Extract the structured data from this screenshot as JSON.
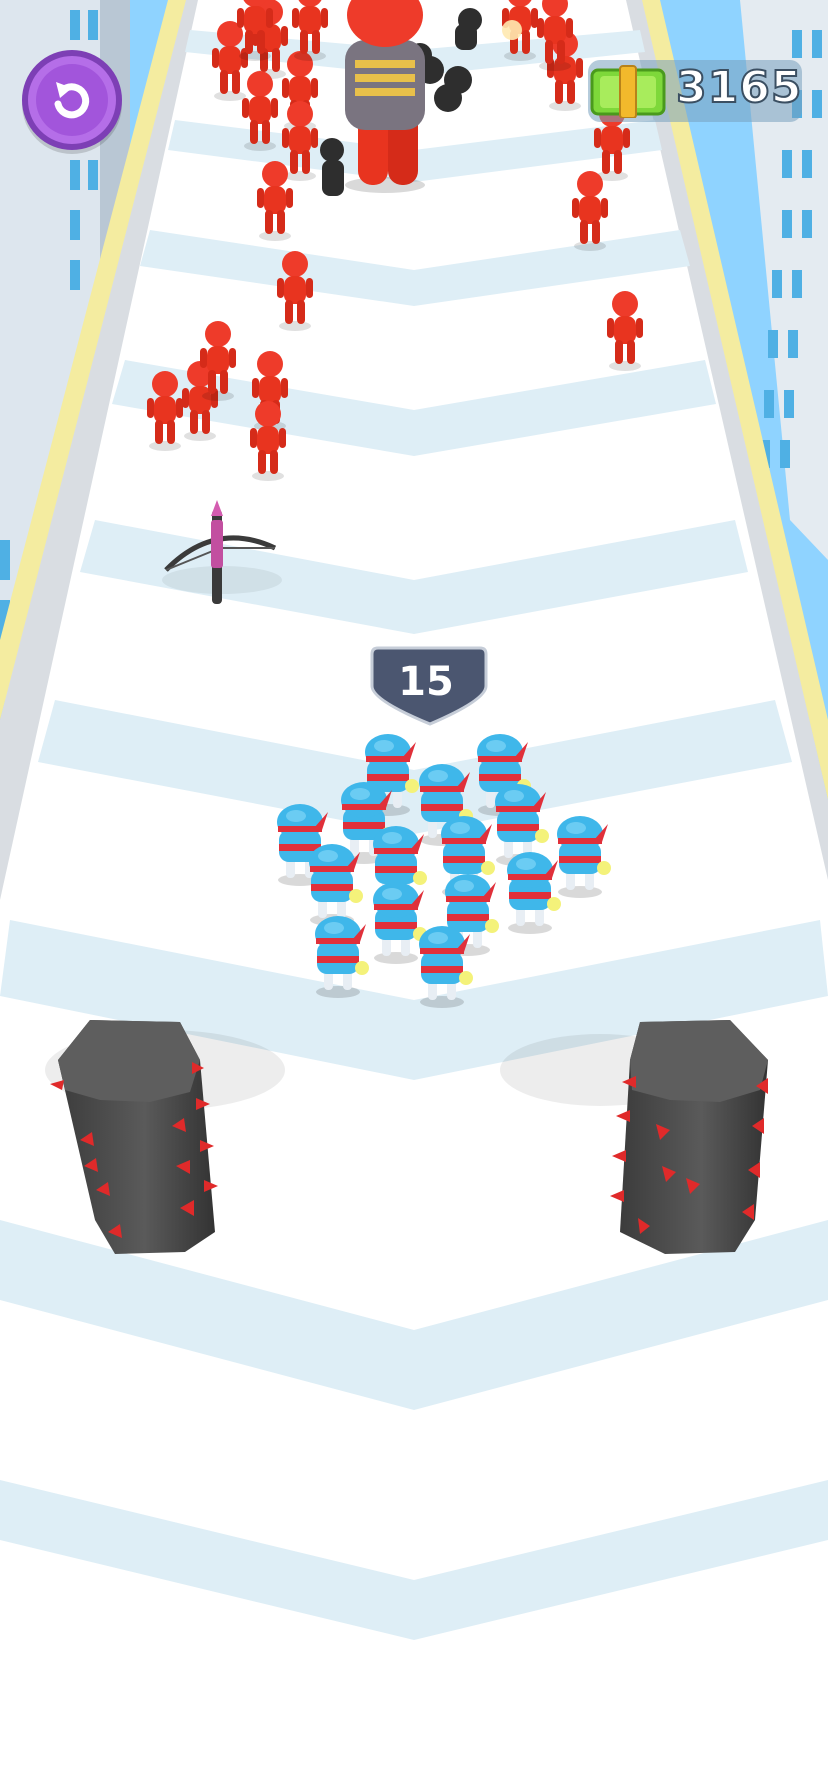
{
  "hud": {
    "restart_icon": "restart-icon",
    "money_icon": "cash-icon",
    "money": "3165"
  },
  "squad": {
    "count": "15"
  },
  "colors": {
    "enemy": "#ee3b2a",
    "player": "#3fb7ea",
    "hazard": "#4a4a4a",
    "spike": "#e02a2a",
    "restart_button": "#b56ee8",
    "cash": "#7ed83a"
  }
}
